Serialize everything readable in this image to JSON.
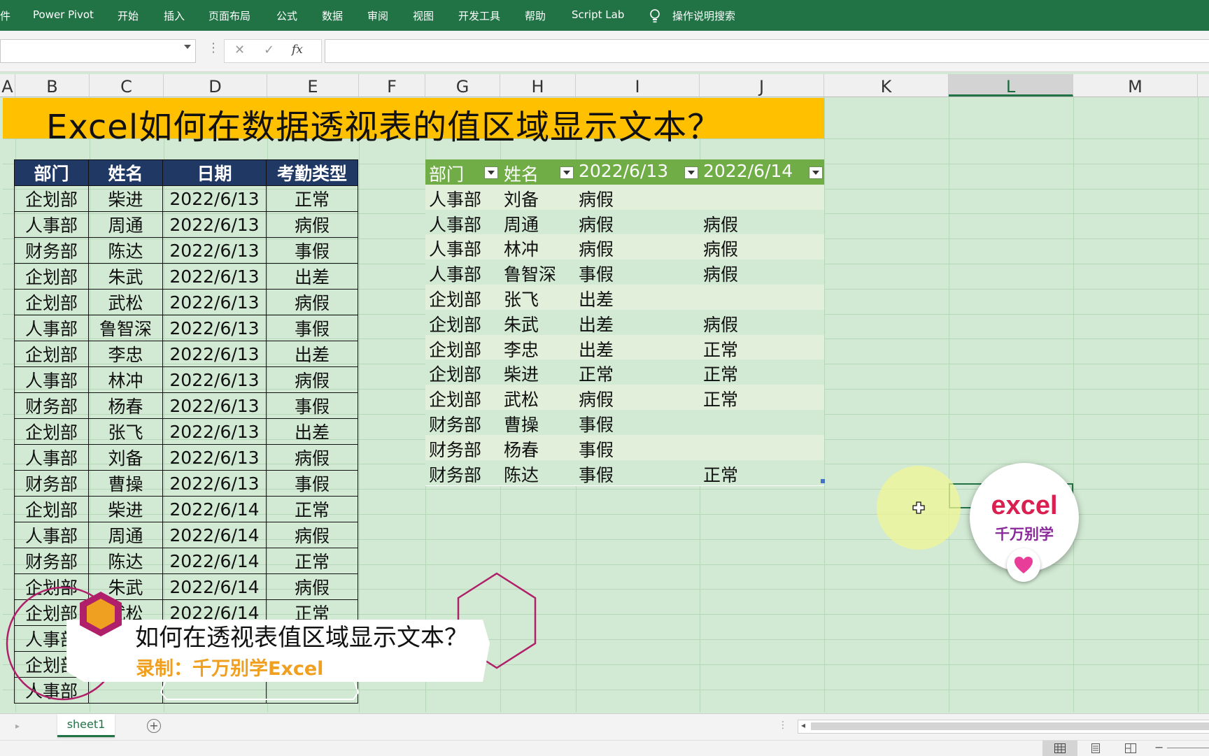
{
  "ribbon": {
    "tabs": [
      "件",
      "Power Pivot",
      "开始",
      "插入",
      "页面布局",
      "公式",
      "数据",
      "审阅",
      "视图",
      "开发工具",
      "帮助",
      "Script Lab",
      "操作说明搜索"
    ]
  },
  "formula_bar": {
    "name_box": "",
    "cancel_icon": "✕",
    "enter_icon": "✓",
    "fx_label": "fx",
    "formula": ""
  },
  "columns": [
    "A",
    "B",
    "C",
    "D",
    "E",
    "F",
    "G",
    "H",
    "I",
    "J",
    "K",
    "L",
    "M"
  ],
  "selected_column": "L",
  "title": "Excel如何在数据透视表的值区域显示文本？",
  "source_table": {
    "headers": [
      "部门",
      "姓名",
      "日期",
      "考勤类型"
    ],
    "rows": [
      [
        "企划部",
        "柴进",
        "2022/6/13",
        "正常"
      ],
      [
        "人事部",
        "周通",
        "2022/6/13",
        "病假"
      ],
      [
        "财务部",
        "陈达",
        "2022/6/13",
        "事假"
      ],
      [
        "企划部",
        "朱武",
        "2022/6/13",
        "出差"
      ],
      [
        "企划部",
        "武松",
        "2022/6/13",
        "病假"
      ],
      [
        "人事部",
        "鲁智深",
        "2022/6/13",
        "事假"
      ],
      [
        "企划部",
        "李忠",
        "2022/6/13",
        "出差"
      ],
      [
        "人事部",
        "林冲",
        "2022/6/13",
        "病假"
      ],
      [
        "财务部",
        "杨春",
        "2022/6/13",
        "事假"
      ],
      [
        "企划部",
        "张飞",
        "2022/6/13",
        "出差"
      ],
      [
        "人事部",
        "刘备",
        "2022/6/13",
        "病假"
      ],
      [
        "财务部",
        "曹操",
        "2022/6/13",
        "事假"
      ],
      [
        "企划部",
        "柴进",
        "2022/6/14",
        "正常"
      ],
      [
        "人事部",
        "周通",
        "2022/6/14",
        "病假"
      ],
      [
        "财务部",
        "陈达",
        "2022/6/14",
        "正常"
      ],
      [
        "企划部",
        "朱武",
        "2022/6/14",
        "病假"
      ],
      [
        "企划部",
        "武松",
        "2022/6/14",
        "正常"
      ],
      [
        "人事部",
        "",
        "",
        ""
      ],
      [
        "企划部",
        "",
        "",
        ""
      ],
      [
        "人事部",
        "",
        "",
        ""
      ]
    ]
  },
  "pivot_table": {
    "headers": [
      "部门",
      "姓名",
      "2022/6/13",
      "2022/6/14"
    ],
    "rows": [
      [
        "人事部",
        "刘备",
        "病假",
        ""
      ],
      [
        "人事部",
        "周通",
        "病假",
        "病假"
      ],
      [
        "人事部",
        "林冲",
        "病假",
        "病假"
      ],
      [
        "人事部",
        "鲁智深",
        "事假",
        "病假"
      ],
      [
        "企划部",
        "张飞",
        "出差",
        ""
      ],
      [
        "企划部",
        "朱武",
        "出差",
        "病假"
      ],
      [
        "企划部",
        "李忠",
        "出差",
        "正常"
      ],
      [
        "企划部",
        "柴进",
        "正常",
        "正常"
      ],
      [
        "企划部",
        "武松",
        "病假",
        "正常"
      ],
      [
        "财务部",
        "曹操",
        "事假",
        ""
      ],
      [
        "财务部",
        "杨春",
        "事假",
        ""
      ],
      [
        "财务部",
        "陈达",
        "事假",
        "正常"
      ]
    ]
  },
  "overlay": {
    "caption": "如何在透视表值区域显示文本？",
    "credit": "录制：千万别学Excel"
  },
  "logo": {
    "line1": "excel",
    "line2": "千万别学"
  },
  "sheet_tabs": [
    "sheet1"
  ],
  "colors": {
    "ribbon": "#217346",
    "grid_bg": "#d2ead4",
    "title_bg": "#ffc000",
    "src_header": "#203864",
    "pivot_header": "#70ad47",
    "pivot_band1": "#e2efda",
    "pivot_band2": "#d2ead4",
    "accent_orange": "#f0a020",
    "accent_magenta": "#b0206a"
  }
}
